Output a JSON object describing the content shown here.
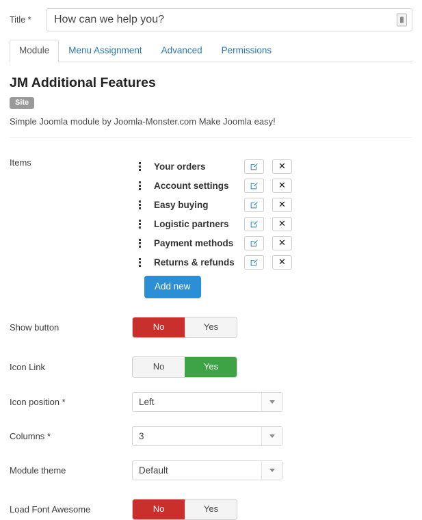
{
  "title_field": {
    "label": "Title *",
    "value": "How can we help you?",
    "placeholder": "Title",
    "addon_icon": "text-input-addon-icon"
  },
  "tabs": [
    {
      "label": "Module",
      "active": true
    },
    {
      "label": "Menu Assignment",
      "active": false
    },
    {
      "label": "Advanced",
      "active": false
    },
    {
      "label": "Permissions",
      "active": false
    }
  ],
  "module": {
    "name": "JM Additional Features",
    "badge": "Site",
    "description": "Simple Joomla module by Joomla-Monster.com Make Joomla easy!"
  },
  "items_field": {
    "label": "Items",
    "add_button": "Add new",
    "edit_icon": "edit-pencil-icon",
    "delete_icon": "close-x-icon",
    "drag_icon": "drag-handle-icon",
    "items": [
      {
        "name": "Your orders"
      },
      {
        "name": "Account settings"
      },
      {
        "name": "Easy buying"
      },
      {
        "name": "Logistic partners"
      },
      {
        "name": "Payment methods"
      },
      {
        "name": "Returns & refunds"
      }
    ]
  },
  "toggles": [
    {
      "label": "Show button",
      "no": "No",
      "yes": "Yes",
      "selected": "No"
    },
    {
      "label": "Icon Link",
      "no": "No",
      "yes": "Yes",
      "selected": "Yes"
    }
  ],
  "selects": [
    {
      "label": "Icon position *",
      "value": "Left"
    },
    {
      "label": "Columns *",
      "value": "3"
    },
    {
      "label": "Module theme",
      "value": "Default"
    }
  ],
  "toggles_bottom": [
    {
      "label": "Load Font Awesome",
      "no": "No",
      "yes": "Yes",
      "selected": "No"
    }
  ],
  "colors": {
    "accent_blue": "#2a8fd4",
    "link_blue": "#2a7ab0",
    "danger_red": "#c9302c",
    "success_green": "#3da345",
    "badge_gray": "#999999"
  }
}
